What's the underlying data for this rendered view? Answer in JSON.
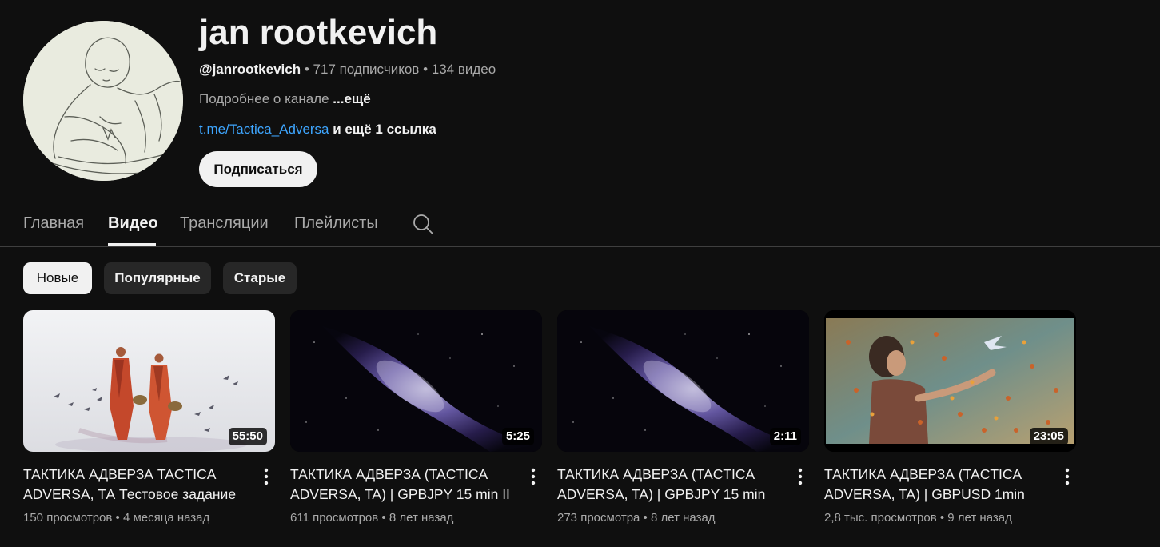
{
  "channel": {
    "name": "jan rootkevich",
    "handle": "@janrootkevich",
    "subscribers": "717 подписчиков",
    "videos": "134 видео",
    "about": "Подробнее о канале",
    "about_more": "...ещё",
    "link": "t.me/Tactica_Adversa",
    "links_more": "и ещё 1 ссылка",
    "subscribe_label": "Подписаться"
  },
  "tabs": [
    {
      "label": "Главная",
      "active": false
    },
    {
      "label": "Видео",
      "active": true
    },
    {
      "label": "Трансляции",
      "active": false
    },
    {
      "label": "Плейлисты",
      "active": false
    }
  ],
  "tabs_search_icon": "search-icon",
  "filters": [
    {
      "label": "Новые",
      "active": true
    },
    {
      "label": "Популярные",
      "active": false
    },
    {
      "label": "Старые",
      "active": false
    }
  ],
  "videos": [
    {
      "title": "ТАКТИКА АДВЕРЗА TACTICA ADVERSA, ТА Тестовое задание",
      "duration": "55:50",
      "views": "150 просмотров",
      "age": "4 месяца назад",
      "thumbnail": "monks-walking"
    },
    {
      "title": "ТАКТИКА АДВЕРЗА (TACTICA ADVERSA, TA) | GPBJPY 15 min II",
      "duration": "5:25",
      "views": "611 просмотров",
      "age": "8 лет назад",
      "thumbnail": "nebula"
    },
    {
      "title": "ТАКТИКА АДВЕРЗА (TACTICA ADVERSA, TA) | GPBJPY 15 min",
      "duration": "2:11",
      "views": "273 просмотра",
      "age": "8 лет назад",
      "thumbnail": "nebula"
    },
    {
      "title": "ТАКТИКА АДВЕРЗА (TACTICA ADVERSA, TA) | GBPUSD 1min",
      "duration": "23:05",
      "views": "2,8 тыс. просмотров",
      "age": "9 лет назад",
      "thumbnail": "girl-with-leaves"
    }
  ],
  "colors": {
    "background": "#0f0f0f",
    "link": "#3ea6ff",
    "secondary_text": "#aaaaaa",
    "chip": "#272727"
  }
}
